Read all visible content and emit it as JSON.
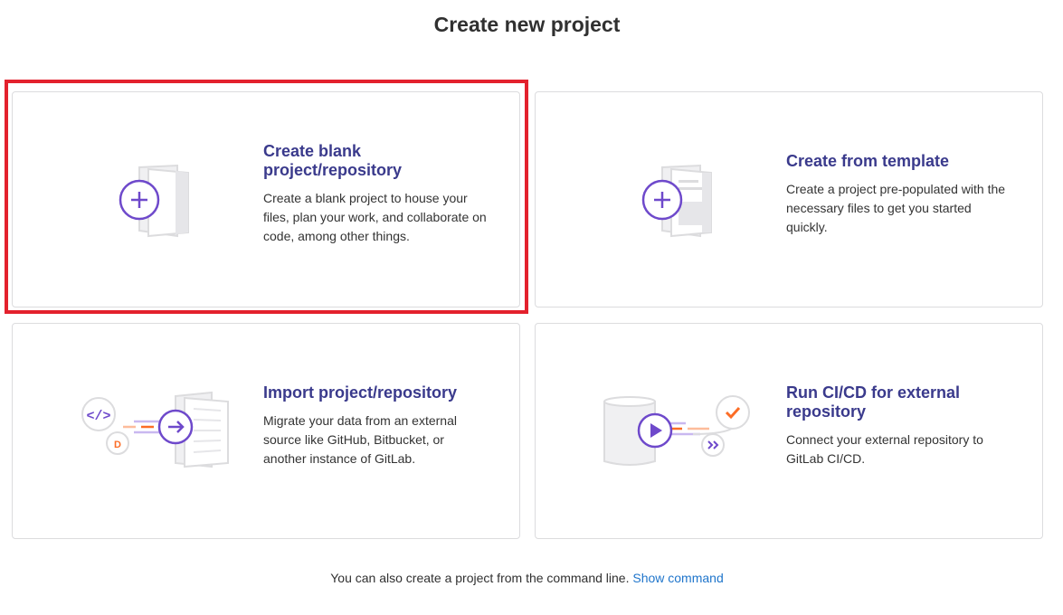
{
  "header": {
    "title": "Create new project"
  },
  "cards": [
    {
      "title": "Create blank project/repository",
      "description": "Create a blank project to house your files, plan your work, and collaborate on code, among other things."
    },
    {
      "title": "Create from template",
      "description": "Create a project pre-populated with the necessary files to get you started quickly."
    },
    {
      "title": "Import project/repository",
      "description": "Migrate your data from an external source like GitHub, Bitbucket, or another instance of GitLab."
    },
    {
      "title": "Run CI/CD for external repository",
      "description": "Connect your external repository to GitLab CI/CD."
    }
  ],
  "footer": {
    "text": "You can also create a project from the command line.",
    "link": "Show command"
  },
  "colors": {
    "accent": "#6e49cb",
    "title": "#3a3a8c",
    "link": "#1f75cb",
    "highlight": "#e3212d",
    "orange": "#fc6d26"
  },
  "icons": [
    "blank-project-illustration",
    "template-illustration",
    "import-illustration",
    "cicd-illustration"
  ]
}
